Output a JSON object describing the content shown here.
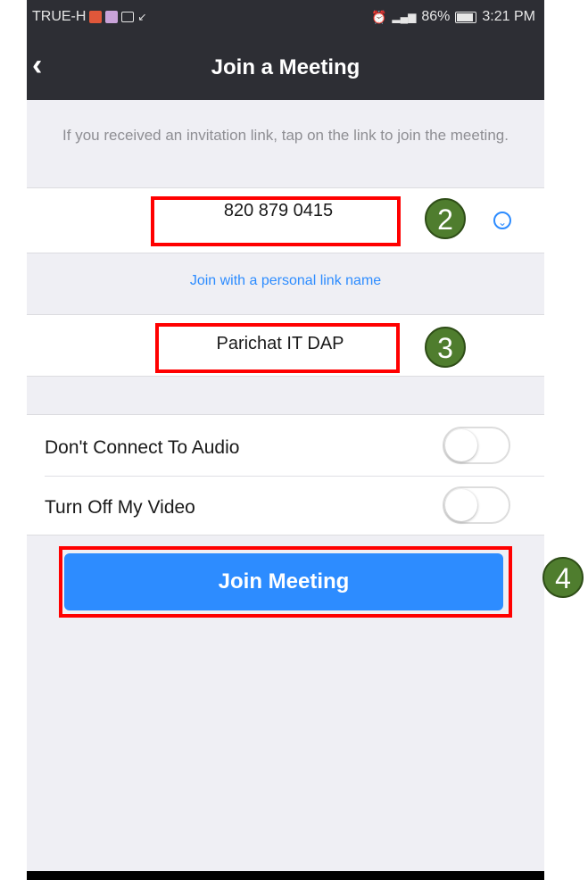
{
  "status_bar": {
    "carrier": "TRUE-H",
    "battery": "86%",
    "time": "3:21 PM"
  },
  "nav": {
    "back_icon": "chevron-left-icon",
    "title": "Join a Meeting"
  },
  "hint": "If you received an invitation link, tap on the link to join the meeting.",
  "meeting_id": {
    "value": "820 879 0415"
  },
  "personal_link": "Join with a personal link name",
  "name": {
    "value": "Parichat IT DAP"
  },
  "options": [
    {
      "label": "Don't Connect To Audio",
      "on": false
    },
    {
      "label": "Turn Off My Video",
      "on": false
    }
  ],
  "join_button": "Join Meeting",
  "annotations": {
    "badge2": "2",
    "badge3": "3",
    "badge4": "4"
  },
  "colors": {
    "accent": "#2d8cff",
    "highlight": "#ff0000",
    "badge": "#4f7d2e",
    "nav": "#2d2e34"
  }
}
